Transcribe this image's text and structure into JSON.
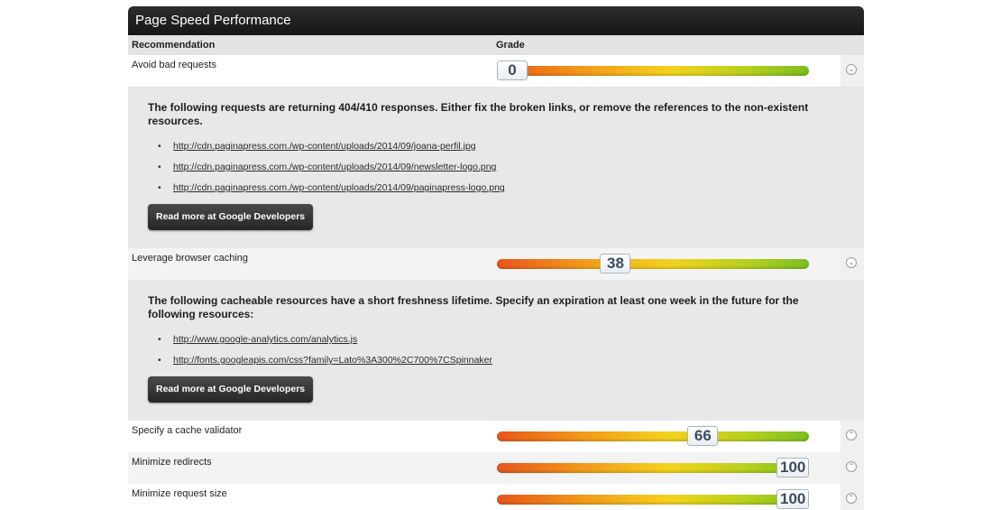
{
  "title": "Page Speed Performance",
  "columns": {
    "recommendation": "Recommendation",
    "grade": "Grade"
  },
  "items": [
    {
      "label": "Avoid bad requests",
      "grade": "0",
      "grade_fraction": 0.0,
      "expanded": true,
      "toggle": "chevron-down-icon",
      "heading": "The following requests are returning 404/410 responses. Either fix the broken links, or remove the references to the non-existent resources.",
      "links": [
        "http://cdn.paginapress.com./wp-content/uploads/2014/09/joana-perfil.jpg",
        "http://cdn.paginapress.com./wp-content/uploads/2014/09/newsletter-logo.png",
        "http://cdn.paginapress.com./wp-content/uploads/2014/09/paginapress-logo.png"
      ],
      "button": "Read more at Google Developers"
    },
    {
      "label": "Leverage browser caching",
      "grade": "38",
      "grade_fraction": 0.38,
      "expanded": true,
      "toggle": "chevron-down-icon",
      "heading": "The following cacheable resources have a short freshness lifetime. Specify an expiration at least one week in the future for the following resources:",
      "links": [
        "http://www.google-analytics.com/analytics.js",
        "http://fonts.googleapis.com/css?family=Lato%3A300%2C700%7CSpinnaker"
      ],
      "button": "Read more at Google Developers"
    },
    {
      "label": "Specify a cache validator",
      "grade": "66",
      "grade_fraction": 0.66,
      "expanded": false,
      "toggle": "chevron-up-icon"
    },
    {
      "label": "Minimize redirects",
      "grade": "100",
      "grade_fraction": 1.0,
      "expanded": false,
      "toggle": "chevron-up-icon"
    },
    {
      "label": "Minimize request size",
      "grade": "100",
      "grade_fraction": 1.0,
      "expanded": false,
      "toggle": "chevron-up-icon"
    }
  ]
}
